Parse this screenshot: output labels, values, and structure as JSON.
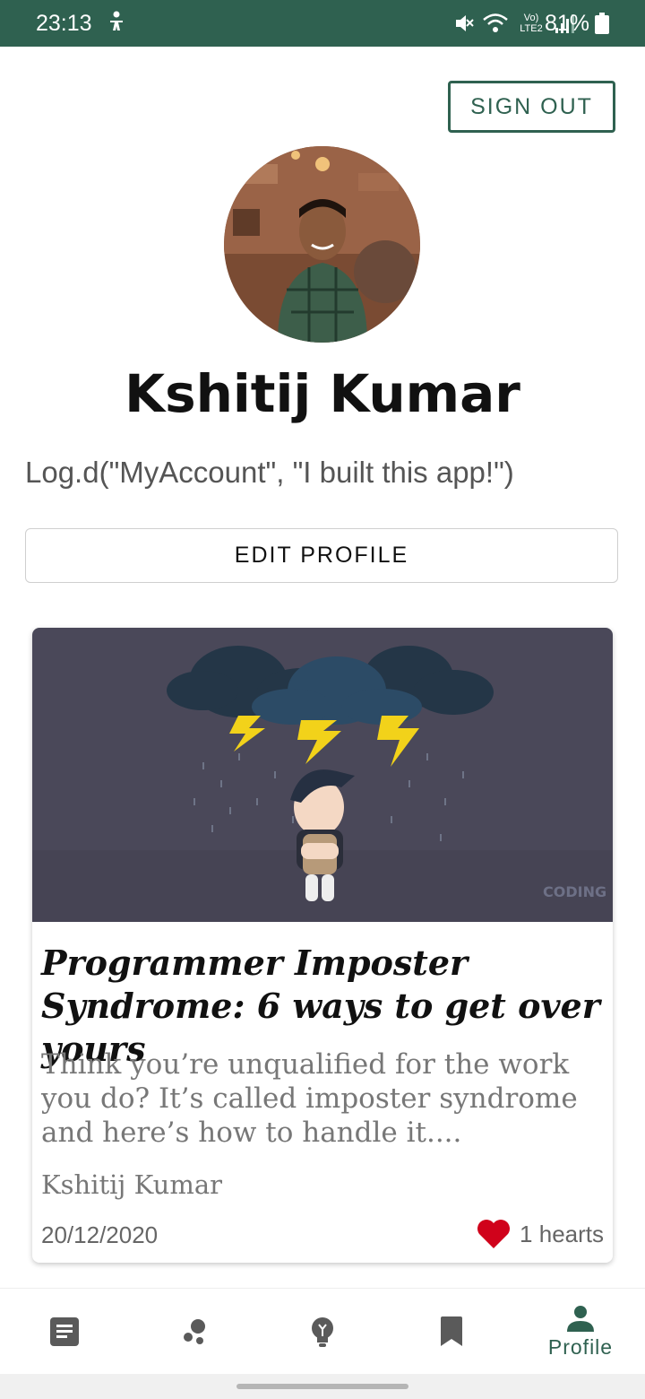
{
  "status_bar": {
    "time": "23:13",
    "network": "Vo) LTE2",
    "battery_percent": "81%"
  },
  "header": {
    "sign_out_label": "SIGN OUT"
  },
  "profile": {
    "name": "Kshitij Kumar",
    "bio": "Log.d(\"MyAccount\", \"I built this app!\")",
    "edit_label": "EDIT PROFILE"
  },
  "post": {
    "title": "Programmer Imposter Syndrome: 6 ways to get over yours",
    "excerpt": "Think you’re unqualified for the work you do? It’s called imposter syndrome and here’s how to handle it....",
    "author": "Kshitij Kumar",
    "date": "20/12/2020",
    "hearts": "1 hearts",
    "cover_watermark": "CODING DOJO"
  },
  "bottom_nav": {
    "items": [
      {
        "icon": "article-icon",
        "label": ""
      },
      {
        "icon": "bubbles-icon",
        "label": ""
      },
      {
        "icon": "lightbulb-icon",
        "label": ""
      },
      {
        "icon": "bookmark-icon",
        "label": ""
      },
      {
        "icon": "person-icon",
        "label": "Profile"
      }
    ]
  },
  "colors": {
    "primary": "#2f6150",
    "heart": "#d0021b",
    "nav_icon": "#5a5a5a"
  }
}
